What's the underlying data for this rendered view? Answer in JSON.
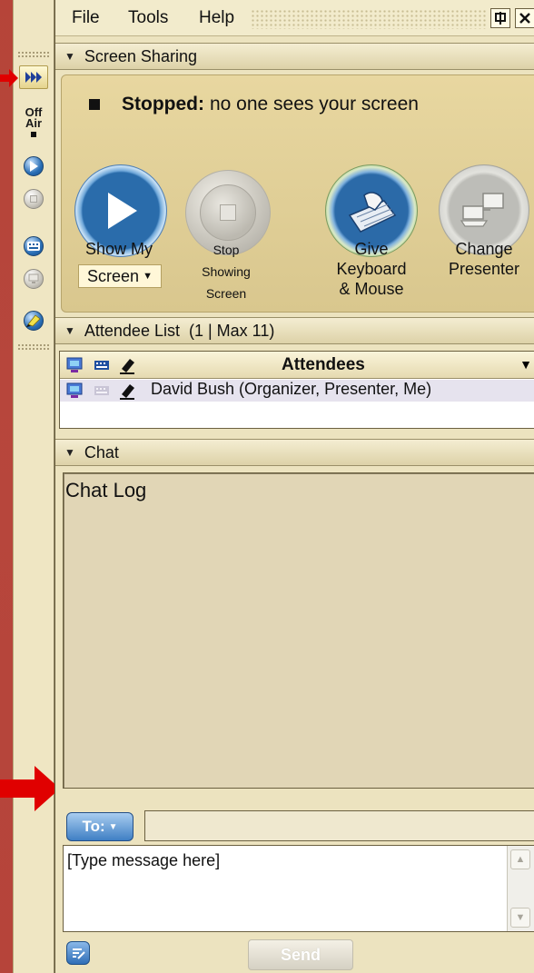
{
  "menu": {
    "file": "File",
    "tools": "Tools",
    "help": "Help"
  },
  "left_strip": {
    "off_air_line1": "Off",
    "off_air_line2": "Air"
  },
  "screen_sharing": {
    "header": "Screen Sharing",
    "status_bold": "Stopped:",
    "status_rest": "no one sees your screen",
    "show_my_label": "Show My",
    "screen_dropdown": "Screen",
    "stop_line1": "Stop",
    "stop_line2": "Showing",
    "stop_line3": "Screen",
    "give_line1": "Give",
    "give_line2": "Keyboard",
    "give_line3": "& Mouse",
    "change_line1": "Change",
    "change_line2": "Presenter"
  },
  "attendee_list": {
    "header": "Attendee List",
    "count": "(1 | Max 11)",
    "column_title": "Attendees",
    "rows": [
      {
        "name": "David Bush (Organizer, Presenter, Me)"
      }
    ]
  },
  "chat": {
    "header": "Chat",
    "log_label": "Chat Log",
    "to_button": "To:",
    "message_placeholder": "[Type message here]",
    "send_button": "Send"
  },
  "icons": {
    "arrows": "red-arrow",
    "expand": "fast-forward-icon",
    "play": "play-icon",
    "stop": "stop-icon",
    "keyboard": "keyboard-icon",
    "presenter": "computers-icon",
    "highlighter": "highlighter-icon",
    "compose": "compose-icon"
  },
  "colors": {
    "accent_blue": "#2a6cab",
    "panel_tan": "#ece3bf",
    "arrow_red": "#e00000"
  }
}
